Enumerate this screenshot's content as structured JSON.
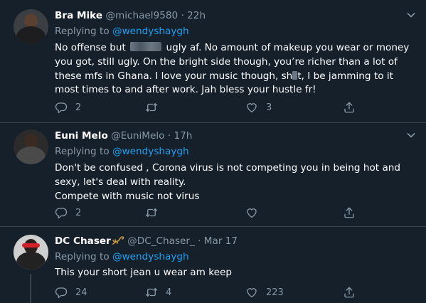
{
  "tweets": [
    {
      "name": "Bra Mike",
      "handle": "@michael9580",
      "time": "22h",
      "replying_label": "Replying to",
      "mention": "@wendyshaygh",
      "text_1": "No offense but",
      "text_2": "ugly af. No amount of makeup you wear or money you got, still ugly. On the bright side though, you’re richer than a lot of these mfs in Ghana. I love your music though, sh",
      "text_3": "t, I be jamming to it most times to and after work. Jah bless your hustle fr!",
      "replies": "2",
      "retweets": "",
      "likes": "3"
    },
    {
      "name": "Euni Melo",
      "handle": "@EuniMelo",
      "time": "17h",
      "replying_label": "Replying to",
      "mention": "@wendyshaygh",
      "lines": [
        "Don't be confused , Corona virus is not competing you in being hot and sexy, let's deal with reality.",
        "Compete with music not virus"
      ],
      "replies": "2",
      "retweets": "",
      "likes": ""
    },
    {
      "name": "DC Chaser",
      "handle": "@DC_Chaser_",
      "time": "Mar 17",
      "replying_label": "Replying to",
      "mention": "@wendyshaygh",
      "text": "This your short jean u wear am keep",
      "replies": "24",
      "retweets": "4",
      "likes": "223"
    }
  ],
  "separator": "·",
  "icons": {
    "reply": "reply-icon",
    "retweet": "retweet-icon",
    "like": "heart-icon",
    "share": "share-icon",
    "more": "chevron-down-icon",
    "emoji": "scorpion-emoji"
  },
  "colors": {
    "background": "#15202b",
    "divider": "#38444d",
    "secondary_text": "#8899a6",
    "link": "#1da1f2"
  }
}
